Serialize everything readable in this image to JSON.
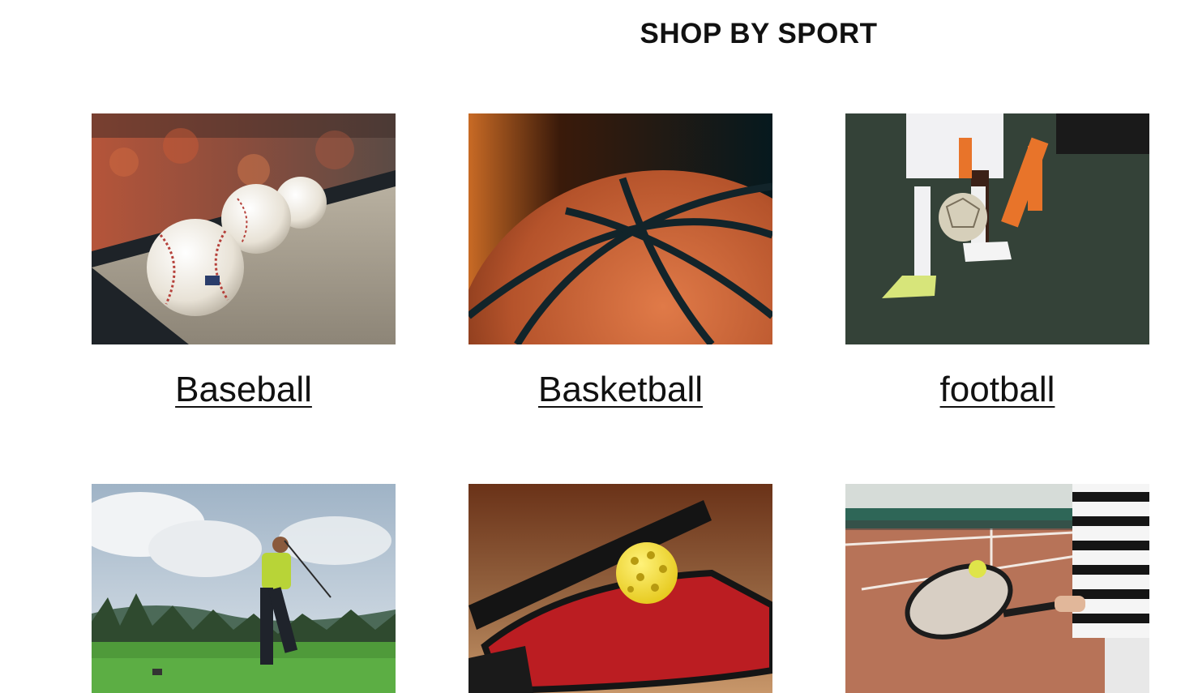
{
  "heading": "SHOP BY SPORT",
  "sports": [
    {
      "label": "Baseball",
      "image": "baseballs-on-stadium-ledge"
    },
    {
      "label": "Basketball",
      "image": "basketball-closeup"
    },
    {
      "label": "football",
      "image": "soccer-players-with-ball"
    },
    {
      "label": "",
      "image": "golfer-swinging-on-course"
    },
    {
      "label": "",
      "image": "pickleball-paddles-and-ball"
    },
    {
      "label": "",
      "image": "tennis-racket-and-ball"
    }
  ]
}
